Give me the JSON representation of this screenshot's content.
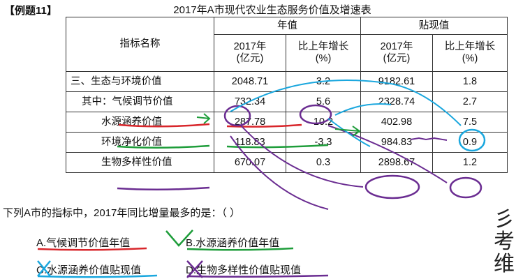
{
  "example_tag": "【例题11】",
  "title": "2017年A市现代农业生态服务价值及增速表",
  "table": {
    "indicator_header": "指标名称",
    "group_headers": [
      "年值",
      "贴现值"
    ],
    "sub_headers": [
      "2017年\n(亿元)",
      "比上年增长\n(%)",
      "2017年\n(亿元)",
      "比上年增长\n(%)"
    ],
    "rows": [
      {
        "name": "三、生态与环境价值",
        "annual": "2048.71",
        "annual_growth": "3.2",
        "discount": "9182.61",
        "discount_growth": "1.8"
      },
      {
        "name": "其中：气候调节价值",
        "annual": "732.34",
        "annual_growth": "5.6",
        "discount": "2328.74",
        "discount_growth": "2.7"
      },
      {
        "name": "水源涵养价值",
        "annual": "287.78",
        "annual_growth": "10.2",
        "discount": "402.98",
        "discount_growth": "7.5"
      },
      {
        "name": "环境净化价值",
        "annual": "118.83",
        "annual_growth": "-3.3",
        "discount": "984.83",
        "discount_growth": "0.9"
      },
      {
        "name": "生物多样性价值",
        "annual": "670.07",
        "annual_growth": "0.3",
        "discount": "2898.67",
        "discount_growth": "1.2"
      }
    ]
  },
  "question": "下列A市的指标中，2017年同比增量最多的是：（    ）",
  "options": {
    "a": "A.气候调节价值年值",
    "b": "B.水源涵养价值年值",
    "c": "C.水源涵养价值贴现值",
    "d": "D.生物多样性价值贴现值"
  },
  "annotation_colors": {
    "red": "#d8262b",
    "green": "#1e9d3a",
    "cyan": "#1aa7de",
    "purple": "#6a2c91"
  }
}
